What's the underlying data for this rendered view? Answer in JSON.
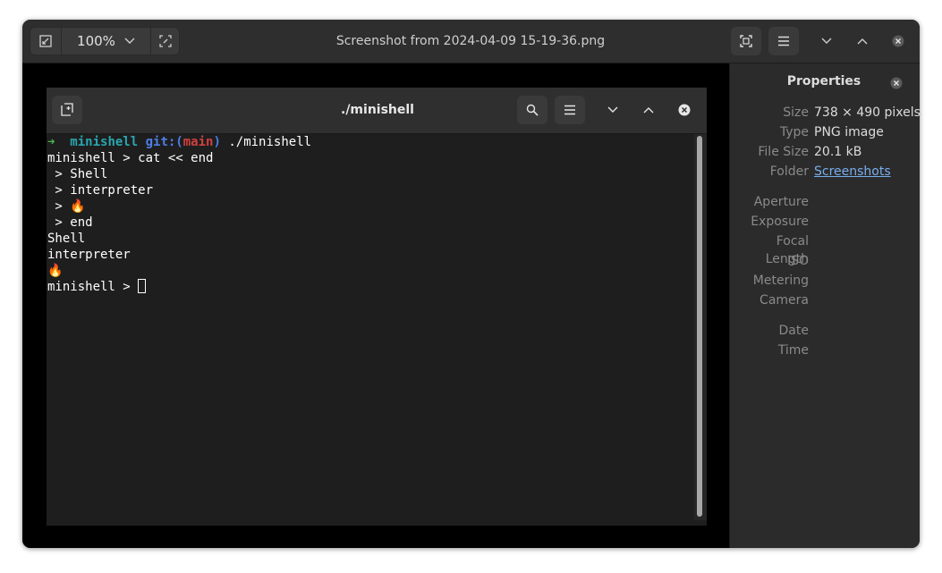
{
  "window": {
    "title": "Screenshot from 2024-04-09 15-19-36.png",
    "zoom": "100%",
    "icons": {
      "zoom_out": "zoom-out-icon",
      "zoom_in": "zoom-in-icon",
      "fullscreen": "fullscreen-icon",
      "menu": "hamburger-menu-icon",
      "minimize": "chevron-down-icon",
      "maximize": "chevron-up-icon",
      "close": "close-icon"
    }
  },
  "terminal": {
    "title": "./minishell",
    "prompt": {
      "arrow": "➜",
      "dir": "minishell",
      "git_prefix": "git:(",
      "branch": "main",
      "git_suffix": ")",
      "command": "./minishell"
    },
    "lines": [
      "minishell > cat << end",
      " > Shell",
      " > interpreter",
      " > 🔥",
      " > end",
      "Shell",
      "interpreter",
      "🔥",
      "minishell > "
    ],
    "colors": {
      "arrow": "#4fb84f",
      "dir": "#2aa6b0",
      "git": "#4d7ee6",
      "branch": "#d04040",
      "text": "#ffffff"
    }
  },
  "properties": {
    "title": "Properties",
    "rows": [
      {
        "label": "Size",
        "value": "738 × 490 pixels"
      },
      {
        "label": "Type",
        "value": "PNG image"
      },
      {
        "label": "File Size",
        "value": "20.1 kB"
      },
      {
        "label": "Folder",
        "value": "Screenshots"
      }
    ],
    "meta": [
      {
        "label": "Aperture",
        "value": ""
      },
      {
        "label": "Exposure",
        "value": ""
      },
      {
        "label": "Focal Length",
        "value": ""
      },
      {
        "label": "ISO",
        "value": ""
      },
      {
        "label": "Metering",
        "value": ""
      },
      {
        "label": "Camera",
        "value": ""
      }
    ],
    "datetime": [
      {
        "label": "Date",
        "value": ""
      },
      {
        "label": "Time",
        "value": ""
      }
    ]
  }
}
